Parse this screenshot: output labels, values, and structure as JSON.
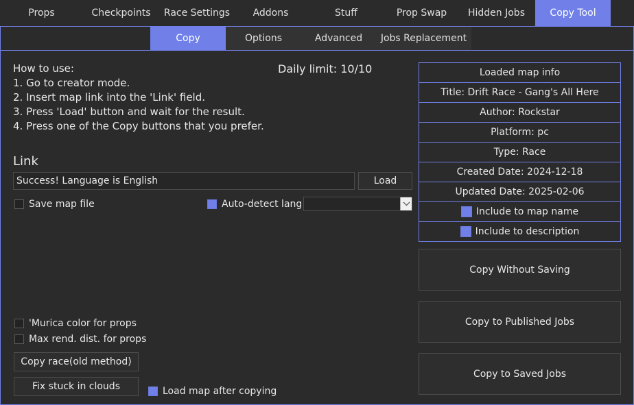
{
  "top_tabs": [
    "Props",
    "Checkpoints",
    "Race Settings",
    "Addons",
    "Stuff",
    "Prop Swap",
    "Hidden Jobs",
    "Copy Tool"
  ],
  "sub_tabs": [
    "Copy",
    "Options",
    "Advanced",
    "Jobs Replacement"
  ],
  "instructions": {
    "title": "How to use:",
    "steps": [
      "1. Go to creator mode.",
      "2. Insert map link into the 'Link' field.",
      "3. Press 'Load' button and wait for the result.",
      "4. Press one of the Copy buttons that you prefer."
    ]
  },
  "daily_limit": "Daily limit: 10/10",
  "link": {
    "label": "Link",
    "value": "Success! Language is English",
    "load_label": "Load"
  },
  "options": {
    "save_map_file": "Save map file",
    "auto_detect_lang": "Auto-detect lang",
    "lang_select_value": ""
  },
  "lower_options": {
    "murica": "'Murica color for props",
    "max_rend": "Max rend. dist. for props",
    "copy_race_old": "Copy race(old method)",
    "fix_stuck": "Fix stuck in clouds",
    "load_after_copy": "Load map after copying"
  },
  "map_info": {
    "header": "Loaded map info",
    "title": "Title: Drift Race - Gang's All Here",
    "author": "Author: Rockstar",
    "platform": "Platform: pc",
    "type": "Type: Race",
    "created": "Created Date: 2024-12-18",
    "updated": "Updated Date: 2025-02-06",
    "include_name": "Include to map name",
    "include_desc": "Include to description"
  },
  "copy_buttons": {
    "without_saving": "Copy Without Saving",
    "published": "Copy to Published Jobs",
    "saved": "Copy to Saved Jobs"
  },
  "colors": {
    "accent": "#7080e8",
    "background": "#2b2b2b"
  }
}
